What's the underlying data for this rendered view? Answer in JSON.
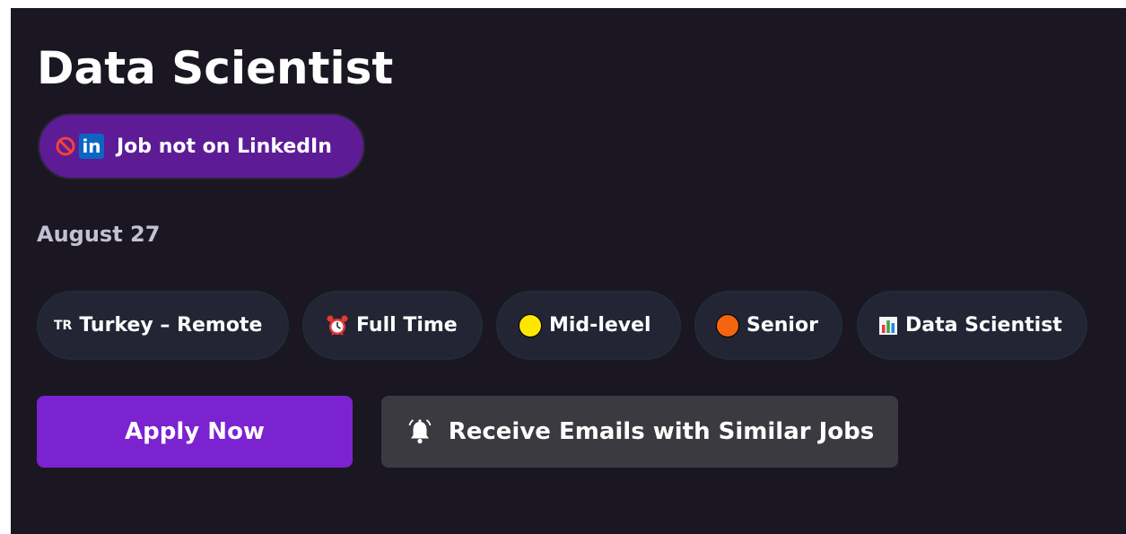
{
  "job": {
    "title": "Data Scientist",
    "date": "August 27"
  },
  "badge": {
    "label": "Job not on LinkedIn",
    "icons": [
      "no-entry-icon",
      "linkedin-icon"
    ],
    "linkedin_glyph": "in",
    "color": "#5e1b96"
  },
  "tags": [
    {
      "icon": "turkey-flag-icon",
      "icon_text": "TR",
      "label": "Turkey – Remote"
    },
    {
      "icon": "alarm-clock-icon",
      "label": "Full Time"
    },
    {
      "icon": "yellow-circle-icon",
      "label": "Mid-level",
      "color": "#ffe600"
    },
    {
      "icon": "orange-circle-icon",
      "label": "Senior",
      "color": "#f4650f"
    },
    {
      "icon": "bar-chart-icon",
      "label": "Data Scientist"
    }
  ],
  "actions": {
    "apply_label": "Apply Now",
    "apply_color": "#7b22d1",
    "alerts_label": "Receive Emails with Similar Jobs",
    "alerts_icon": "bell-icon"
  }
}
